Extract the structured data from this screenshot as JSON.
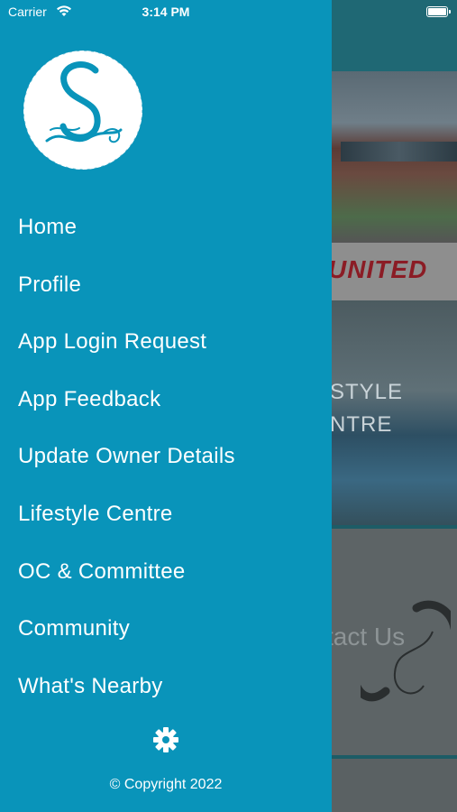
{
  "status_bar": {
    "carrier": "Carrier",
    "time": "3:14 PM",
    "icons": [
      "wifi-icon",
      "battery-icon"
    ]
  },
  "drawer": {
    "logo_icon": "s-monogram-logo",
    "menu_items": [
      {
        "label": "Home"
      },
      {
        "label": "Profile"
      },
      {
        "label": "App Login Request"
      },
      {
        "label": "App Feedback"
      },
      {
        "label": "Update Owner Details"
      },
      {
        "label": "Lifestyle Centre"
      },
      {
        "label": "OC & Committee"
      },
      {
        "label": "Community"
      },
      {
        "label": "What's Nearby"
      }
    ],
    "settings_icon": "gear-icon",
    "copyright": "© Copyright 2022",
    "background_color": "#0994BA"
  },
  "background": {
    "banner_text": "UNITED",
    "tile2_lines": [
      "STYLE",
      "NTRE"
    ],
    "tile3_text": "tact Us"
  }
}
